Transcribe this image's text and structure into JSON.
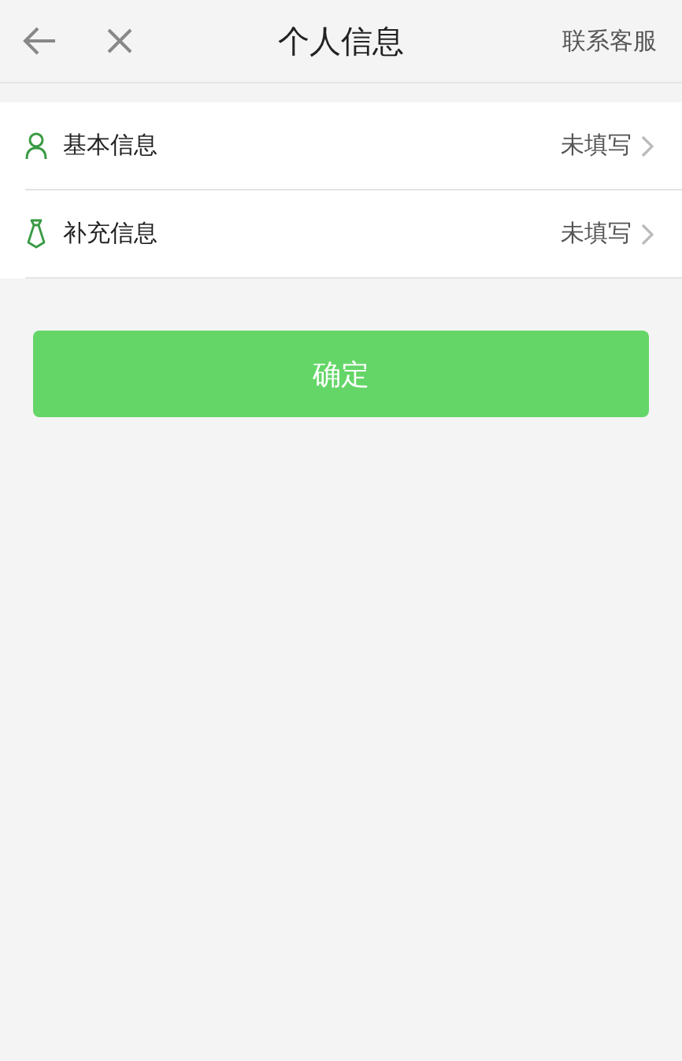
{
  "header": {
    "title": "个人信息",
    "action": "联系客服"
  },
  "rows": [
    {
      "kind": "person",
      "label": "基本信息",
      "status": "未填写"
    },
    {
      "kind": "tie",
      "label": "补充信息",
      "status": "未填写"
    }
  ],
  "confirm_button": "确定"
}
